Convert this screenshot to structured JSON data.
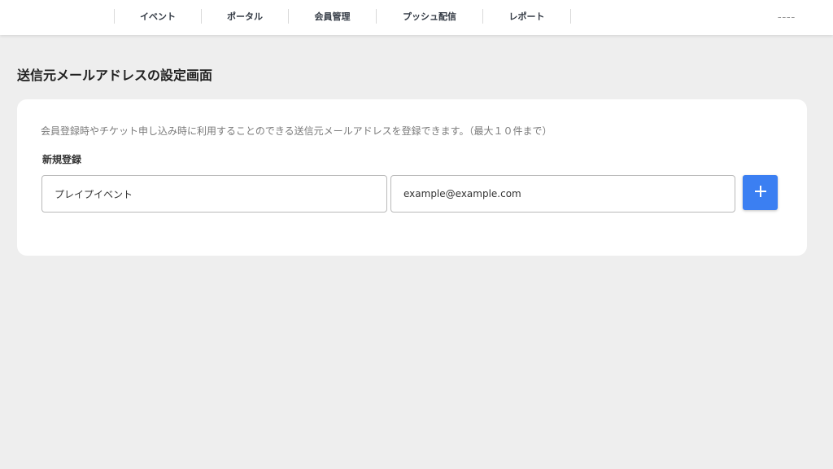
{
  "nav": {
    "items": [
      {
        "label": "イベント"
      },
      {
        "label": "ポータル"
      },
      {
        "label": "会員管理"
      },
      {
        "label": "プッシュ配信"
      },
      {
        "label": "レポート"
      }
    ],
    "right_text": "ｰｰｰｰ"
  },
  "page": {
    "title": "送信元メールアドレスの設定画面"
  },
  "card": {
    "description": "会員登録時やチケット申し込み時に利用することのできる送信元メールアドレスを登録できます。（最大１０件まで）",
    "section_label": "新規登録",
    "name_input": {
      "value": "プレイプイベント"
    },
    "email_input": {
      "value": "example@example.com"
    },
    "add_button_icon": "plus-icon"
  },
  "colors": {
    "background": "#eeeeee",
    "accent": "#3b7ff2"
  }
}
